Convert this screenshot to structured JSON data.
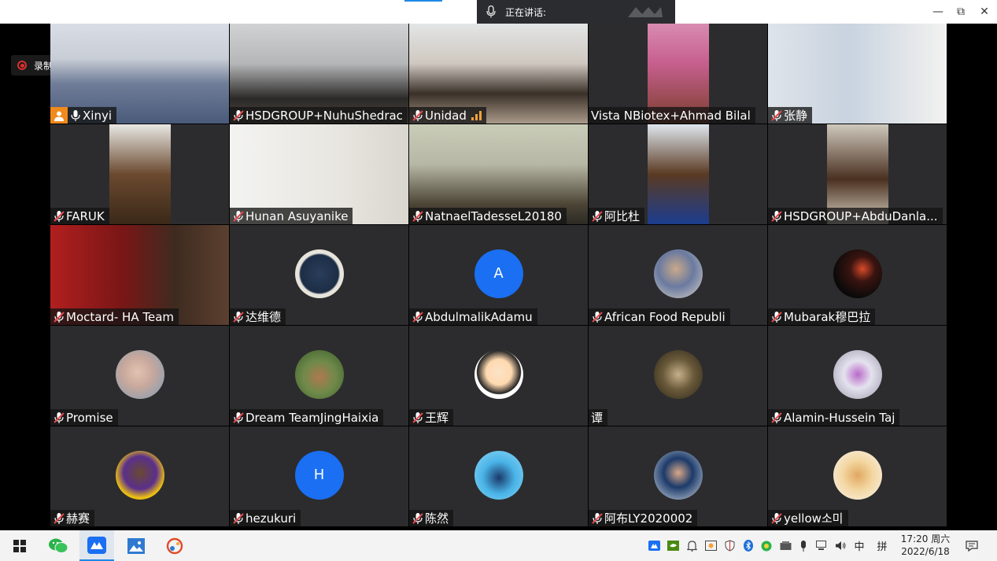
{
  "titlebar": {
    "speaking_label": "正在讲话:",
    "minimize": "—",
    "restore": "⧉",
    "close": "✕"
  },
  "recording": {
    "label": "录制中",
    "color": "#d9302f"
  },
  "participants": [
    {
      "name": "Xinyi",
      "mic": "on",
      "host": true
    },
    {
      "name": "HSDGROUP+NuhuShedrac",
      "mic": "off"
    },
    {
      "name": "Unidad",
      "mic": "off",
      "speaking": true
    },
    {
      "name": "Vista NBiotex+Ahmad Bilal",
      "mic": "none"
    },
    {
      "name": "张静",
      "mic": "off"
    },
    {
      "name": "FARUK",
      "mic": "off"
    },
    {
      "name": "Hunan Asuyanike",
      "mic": "off"
    },
    {
      "name": "NatnaelTadesseL20180",
      "mic": "off"
    },
    {
      "name": "阿比杜",
      "mic": "off"
    },
    {
      "name": "HSDGROUP+AbduDanla...",
      "mic": "off"
    },
    {
      "name": "Moctard- HA Team",
      "mic": "off"
    },
    {
      "name": "达维德",
      "mic": "off"
    },
    {
      "name": "AbdulmalikAdamu",
      "mic": "off",
      "avatar_letter": "A"
    },
    {
      "name": "African Food Republi",
      "mic": "off"
    },
    {
      "name": "Mubarak穆巴拉",
      "mic": "off"
    },
    {
      "name": "Promise",
      "mic": "off"
    },
    {
      "name": "Dream TeamJingHaixia",
      "mic": "off"
    },
    {
      "name": "王辉",
      "mic": "off"
    },
    {
      "name": "谭",
      "mic": "none"
    },
    {
      "name": "Alamin-Hussein Taj",
      "mic": "off"
    },
    {
      "name": "赫赛",
      "mic": "off"
    },
    {
      "name": "hezukuri",
      "mic": "off",
      "avatar_letter": "H"
    },
    {
      "name": "陈然",
      "mic": "off"
    },
    {
      "name": "阿布LY2020002",
      "mic": "off"
    },
    {
      "name": "yellow소미",
      "mic": "off"
    }
  ],
  "taskbar": {
    "apps": [
      "windows-start",
      "wechat",
      "meeting-app",
      "photos",
      "paint"
    ],
    "ime_lang": "中",
    "ime_mode": "拼",
    "time": "17:20 周六",
    "date": "2022/6/18"
  },
  "colors": {
    "accent": "#1e88e5",
    "tile": "#2c2c2e",
    "avatar_blue": "#1a6ff2",
    "host_badge": "#f08a1c"
  }
}
